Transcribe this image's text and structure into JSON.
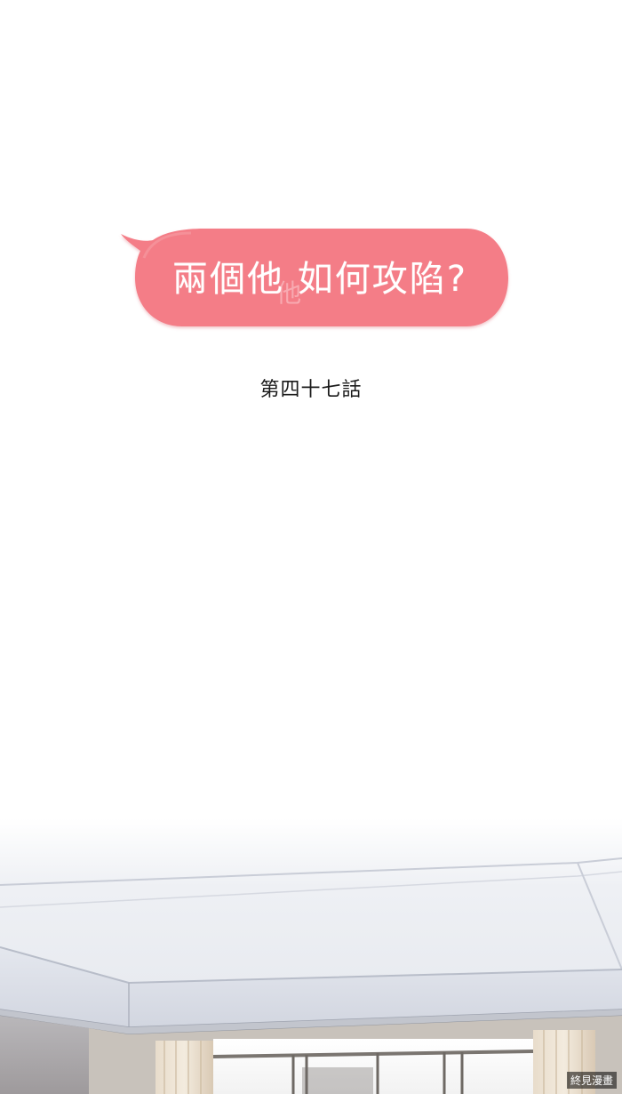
{
  "title_bubble": {
    "text": "兩個他 如何攻陷?",
    "watermark": "他",
    "color": "#f47d87"
  },
  "chapter": {
    "label": "第四十七話"
  },
  "site_watermark": {
    "text": "終見漫畫"
  }
}
